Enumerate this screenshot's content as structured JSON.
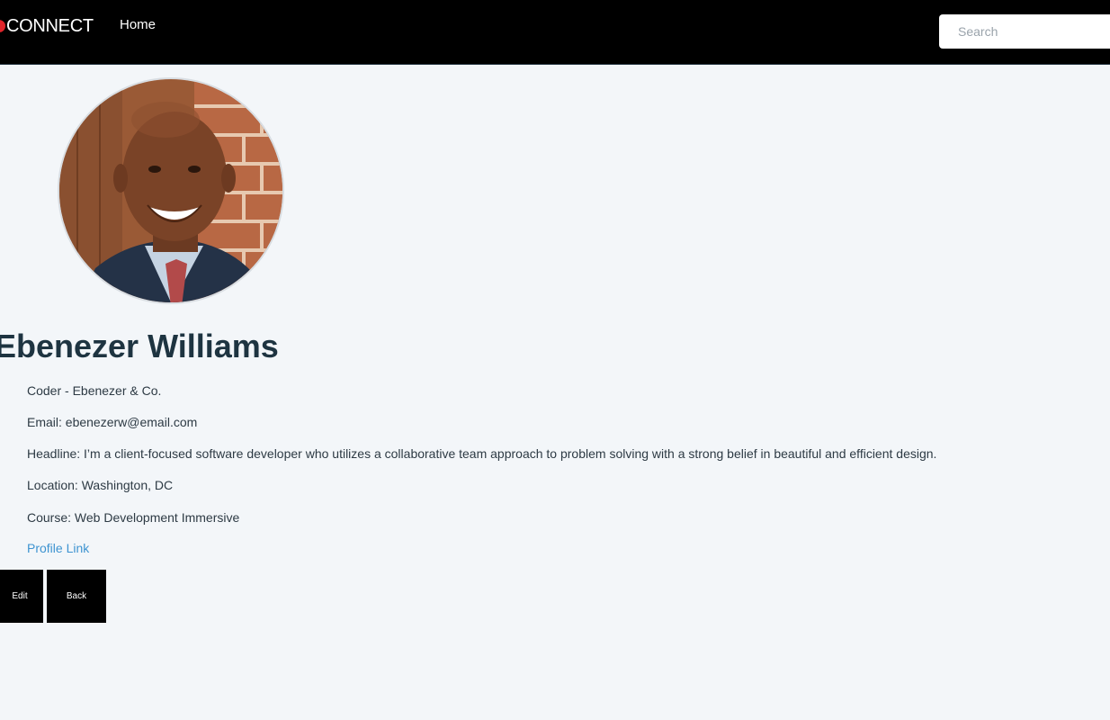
{
  "navbar": {
    "brand": "CONNECT",
    "home_label": "Home",
    "search_placeholder": "Search"
  },
  "profile": {
    "name": "Ebenezer Williams",
    "position": "Coder - Ebenezer & Co.",
    "email": "Email: ebenezerw@email.com",
    "headline": "Headline: I’m a client-focused software developer who utilizes a collaborative team approach to problem solving with a strong belief in beautiful and efficient design.",
    "location": "Location: Washington, DC",
    "course": "Course: Web Development Immersive",
    "profile_link_label": "Profile Link"
  },
  "actions": {
    "edit_label": "Edit",
    "back_label": "Back"
  },
  "colors": {
    "navbar_bg": "#000000",
    "page_bg": "#f3f6f9",
    "link": "#3e94d1",
    "name_text": "#1e3441",
    "brand_mark": "#e0252b"
  }
}
